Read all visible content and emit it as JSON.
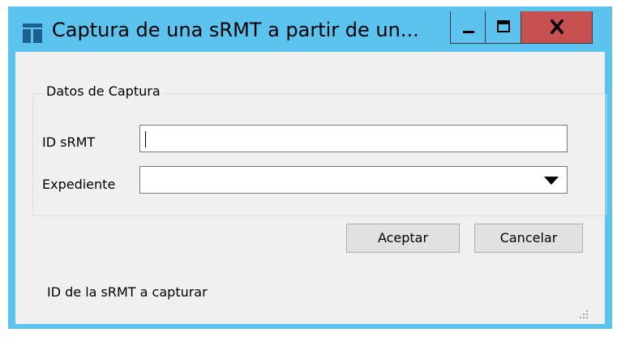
{
  "window": {
    "title": "Captura de una sRMT a partir de un...",
    "icon": "app-window-icon",
    "controls": {
      "minimize": "minimize-icon",
      "maximize": "maximize-icon",
      "close": "close-icon"
    }
  },
  "group": {
    "title": "Datos de Captura"
  },
  "fields": {
    "id_label": "ID sRMT",
    "id_value": "",
    "expediente_label": "Expediente",
    "expediente_value": ""
  },
  "buttons": {
    "accept": "Aceptar",
    "cancel": "Cancelar"
  },
  "status": "ID de la sRMT a capturar",
  "colors": {
    "titlebar": "#5bc3ee",
    "close": "#c75050",
    "client": "#f0f0f0"
  }
}
